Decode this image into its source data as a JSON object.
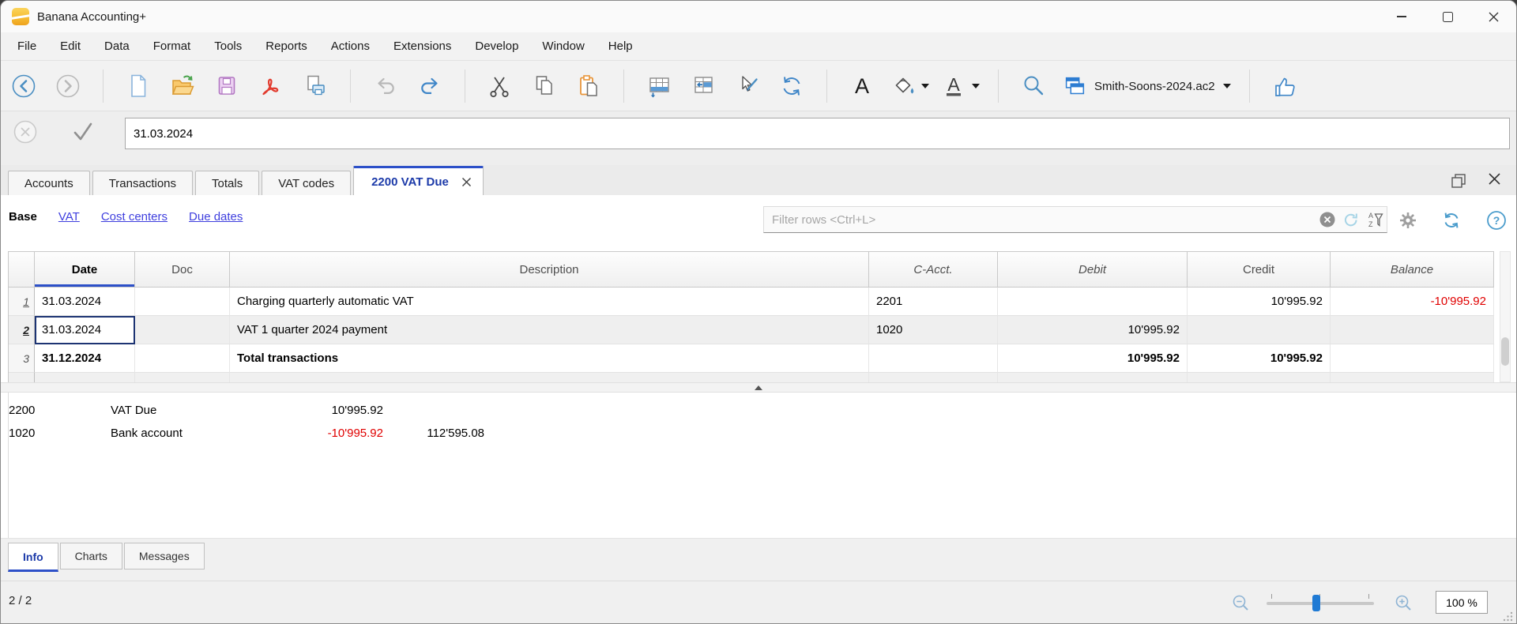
{
  "window": {
    "title": "Banana Accounting+"
  },
  "menu": {
    "items": [
      "File",
      "Edit",
      "Data",
      "Format",
      "Tools",
      "Reports",
      "Actions",
      "Extensions",
      "Develop",
      "Window",
      "Help"
    ]
  },
  "toolbar": {
    "file_selector": "Smith-Soons-2024.ac2"
  },
  "edit_row": {
    "value": "31.03.2024"
  },
  "tabs": {
    "items": [
      "Accounts",
      "Transactions",
      "Totals",
      "VAT codes"
    ],
    "active": "2200 VAT Due"
  },
  "subheader": {
    "views": [
      "Base",
      "VAT",
      "Cost centers",
      "Due dates"
    ],
    "active_view": "Base",
    "filter_placeholder": "Filter rows <Ctrl+L>"
  },
  "table": {
    "columns": [
      "Date",
      "Doc",
      "Description",
      "C-Acct.",
      "Debit",
      "Credit",
      "Balance"
    ],
    "rows": [
      {
        "num": "1",
        "date": "31.03.2024",
        "doc": "",
        "description": "Charging quarterly automatic VAT",
        "c_acct": "2201",
        "debit": "",
        "credit": "10'995.92",
        "balance": "-10'995.92"
      },
      {
        "num": "2",
        "date": "31.03.2024",
        "doc": "",
        "description": "VAT 1 quarter 2024 payment",
        "c_acct": "1020",
        "debit": "10'995.92",
        "credit": "",
        "balance": ""
      },
      {
        "num": "3",
        "date": "31.12.2024",
        "doc": "",
        "description": "Total transactions",
        "c_acct": "",
        "debit": "10'995.92",
        "credit": "10'995.92",
        "balance": ""
      }
    ]
  },
  "info_panel": {
    "rows": [
      {
        "account": "2200",
        "name": "VAT Due",
        "balance": "10'995.92",
        "extra": ""
      },
      {
        "account": "1020",
        "name": "Bank account",
        "balance": "-10'995.92",
        "extra": "112'595.08"
      }
    ]
  },
  "bottom_tabs": {
    "items": [
      "Info",
      "Charts",
      "Messages"
    ],
    "active": "Info"
  },
  "status_bar": {
    "position": "2 / 2",
    "zoom": "100 %"
  },
  "icons": {
    "text_a": "A",
    "font_color_a": "A",
    "help": "?",
    "sort_a": "A",
    "sort_z": "Z"
  },
  "colors": {
    "accent_blue": "#2d50c8",
    "active_tab_text": "#1c3aa9",
    "link": "#3e3ede",
    "negative": "#e00000",
    "selection_border": "#1d3473",
    "toolbar_blue": "#4a8ec2",
    "slider_blue": "#1f7ad4",
    "logo_yellow": "#f6bd33"
  }
}
